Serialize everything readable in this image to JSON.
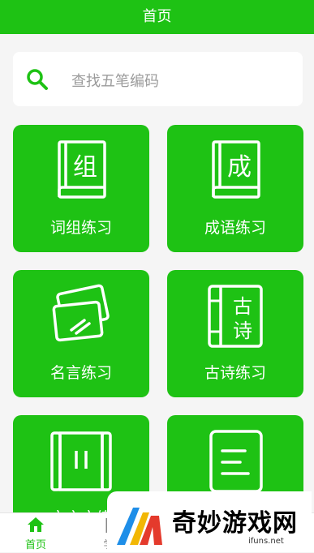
{
  "header": {
    "title": "首页"
  },
  "search": {
    "placeholder": "查找五笔编码",
    "icon": "search-icon"
  },
  "cards": [
    {
      "label": "词组练习",
      "glyph": "组",
      "icon": "book-icon"
    },
    {
      "label": "成语练习",
      "glyph": "成",
      "icon": "book-icon"
    },
    {
      "label": "名言练习",
      "icon": "cards-icon"
    },
    {
      "label": "古诗练习",
      "glyph1": "古",
      "glyph2": "诗",
      "icon": "scroll-book-icon"
    },
    {
      "label": "文言文练",
      "icon": "scroll-icon"
    },
    {
      "label": "",
      "icon": "document-icon"
    }
  ],
  "tabbar": {
    "tabs": [
      {
        "label": "首页",
        "icon": "home-icon"
      },
      {
        "label": "学",
        "icon": "learn-icon"
      }
    ]
  },
  "watermark": {
    "text": "奇妙游戏网",
    "url": "ifuns.net"
  },
  "colors": {
    "brand": "#1ec214",
    "background": "#f5f5f5"
  }
}
